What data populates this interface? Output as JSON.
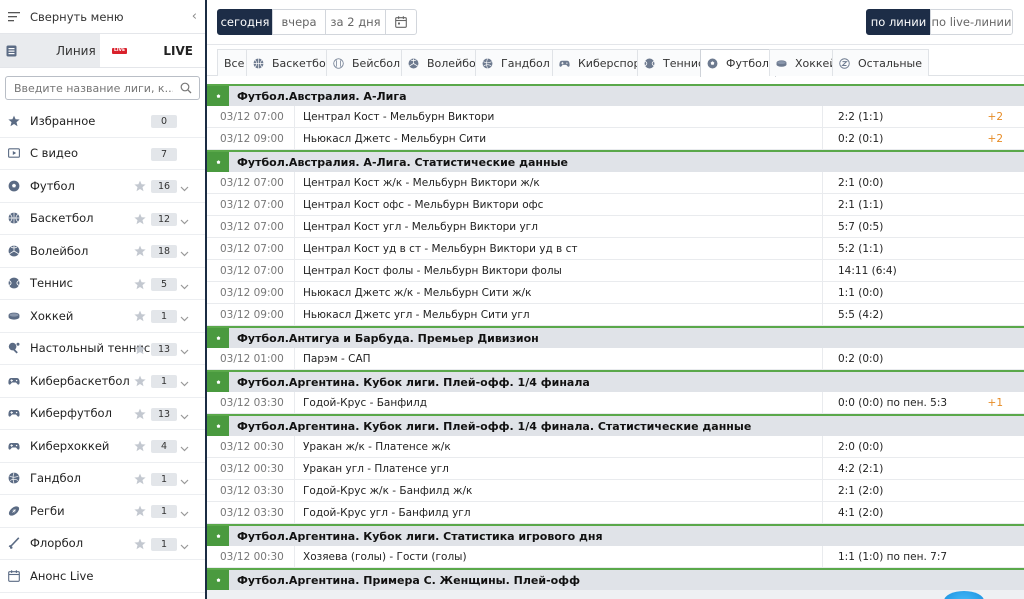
{
  "sidebar": {
    "collapse_label": "Свернуть меню",
    "tab_line": "Линия",
    "tab_live": "LIVE",
    "live_badge": "LIVE",
    "search_placeholder": "Введите название лиги, к...",
    "items": [
      {
        "label": "Избранное",
        "icon": "star-icon",
        "count": "0",
        "fav": false,
        "expand": false
      },
      {
        "label": "С видео",
        "icon": "video-icon",
        "count": "7",
        "fav": false,
        "expand": false
      },
      {
        "label": "Футбол",
        "icon": "soccer-ball-icon",
        "count": "16",
        "fav": true,
        "expand": true
      },
      {
        "label": "Баскетбол",
        "icon": "basketball-icon",
        "count": "12",
        "fav": true,
        "expand": true
      },
      {
        "label": "Волейбол",
        "icon": "volleyball-icon",
        "count": "18",
        "fav": true,
        "expand": true
      },
      {
        "label": "Теннис",
        "icon": "tennis-ball-icon",
        "count": "5",
        "fav": true,
        "expand": true
      },
      {
        "label": "Хоккей",
        "icon": "hockey-puck-icon",
        "count": "1",
        "fav": true,
        "expand": true
      },
      {
        "label": "Настольный теннис",
        "icon": "table-tennis-icon",
        "count": "13",
        "fav": true,
        "expand": true
      },
      {
        "label": "Кибербаскетбол",
        "icon": "gamepad-icon",
        "count": "1",
        "fav": true,
        "expand": true
      },
      {
        "label": "Киберфутбол",
        "icon": "gamepad-icon",
        "count": "13",
        "fav": true,
        "expand": true
      },
      {
        "label": "Киберхоккей",
        "icon": "gamepad-icon",
        "count": "4",
        "fav": true,
        "expand": true
      },
      {
        "label": "Гандбол",
        "icon": "handball-icon",
        "count": "1",
        "fav": true,
        "expand": true
      },
      {
        "label": "Регби",
        "icon": "rugby-ball-icon",
        "count": "1",
        "fav": true,
        "expand": true
      },
      {
        "label": "Флорбол",
        "icon": "floorball-icon",
        "count": "1",
        "fav": true,
        "expand": true
      },
      {
        "label": "Анонс Live",
        "icon": "calendar-icon",
        "count": "",
        "fav": false,
        "expand": false
      }
    ]
  },
  "datebar": {
    "today": "сегодня",
    "yesterday": "вчера",
    "two_days": "за 2 дня",
    "by_line": "по линии",
    "by_live": "по live-линии"
  },
  "sport_tabs": [
    {
      "label": "Все",
      "icon": ""
    },
    {
      "label": "Баскетбол",
      "icon": "basketball-icon"
    },
    {
      "label": "Бейсбол",
      "icon": "baseball-icon"
    },
    {
      "label": "Волейбол",
      "icon": "volleyball-icon"
    },
    {
      "label": "Гандбол",
      "icon": "handball-icon"
    },
    {
      "label": "Киберспорт",
      "icon": "gamepad-icon"
    },
    {
      "label": "Теннис",
      "icon": "tennis-ball-icon"
    },
    {
      "label": "Футбол",
      "icon": "soccer-ball-icon"
    },
    {
      "label": "Хоккей",
      "icon": "hockey-puck-icon"
    },
    {
      "label": "Остальные",
      "icon": "other-sports-icon"
    }
  ],
  "active_sport": "Футбол",
  "colors": {
    "accent": "#1d2d47",
    "league_bar": "#4a9a3f",
    "more_markets": "#e78b24"
  },
  "leagues": [
    {
      "title": "Футбол.Австралия. А-Лига",
      "events": [
        {
          "time": "03/12 07:00",
          "name": "Централ Кост - Мельбурн Виктори",
          "score": "2:2 (1:1)",
          "more": "+2"
        },
        {
          "time": "03/12 09:00",
          "name": "Ньюкасл Джетс - Мельбурн Сити",
          "score": "0:2 (0:1)",
          "more": "+2"
        }
      ]
    },
    {
      "title": "Футбол.Австралия. А-Лига. Статистические данные",
      "events": [
        {
          "time": "03/12 07:00",
          "name": "Централ Кост ж/к - Мельбурн Виктори ж/к",
          "score": "2:1 (0:0)",
          "more": ""
        },
        {
          "time": "03/12 07:00",
          "name": "Централ Кост офс - Мельбурн Виктори офс",
          "score": "2:1 (1:1)",
          "more": ""
        },
        {
          "time": "03/12 07:00",
          "name": "Централ Кост угл - Мельбурн Виктори угл",
          "score": "5:7 (0:5)",
          "more": ""
        },
        {
          "time": "03/12 07:00",
          "name": "Централ Кост уд в ст - Мельбурн Виктори уд в ст",
          "score": "5:2 (1:1)",
          "more": ""
        },
        {
          "time": "03/12 07:00",
          "name": "Централ Кост фолы - Мельбурн Виктори фолы",
          "score": "14:11 (6:4)",
          "more": ""
        },
        {
          "time": "03/12 09:00",
          "name": "Ньюкасл Джетс ж/к - Мельбурн Сити ж/к",
          "score": "1:1 (0:0)",
          "more": ""
        },
        {
          "time": "03/12 09:00",
          "name": "Ньюкасл Джетс угл - Мельбурн Сити угл",
          "score": "5:5 (4:2)",
          "more": ""
        }
      ]
    },
    {
      "title": "Футбол.Антигуа и Барбуда. Премьер Дивизион",
      "events": [
        {
          "time": "03/12 01:00",
          "name": "Парэм - САП",
          "score": "0:2 (0:0)",
          "more": ""
        }
      ]
    },
    {
      "title": "Футбол.Аргентина. Кубок лиги. Плей-офф. 1/4 финала",
      "events": [
        {
          "time": "03/12 03:30",
          "name": "Годой-Крус - Банфилд",
          "score": "0:0 (0:0) по пен. 5:3",
          "more": "+1"
        }
      ]
    },
    {
      "title": "Футбол.Аргентина. Кубок лиги. Плей-офф. 1/4 финала. Статистические данные",
      "events": [
        {
          "time": "03/12 00:30",
          "name": "Уракан ж/к - Платенсе ж/к",
          "score": "2:0 (0:0)",
          "more": ""
        },
        {
          "time": "03/12 00:30",
          "name": "Уракан угл - Платенсе угл",
          "score": "4:2 (2:1)",
          "more": ""
        },
        {
          "time": "03/12 03:30",
          "name": "Годой-Крус ж/к - Банфилд ж/к",
          "score": "2:1 (2:0)",
          "more": ""
        },
        {
          "time": "03/12 03:30",
          "name": "Годой-Крус угл - Банфилд угл",
          "score": "4:1 (2:0)",
          "more": ""
        }
      ]
    },
    {
      "title": "Футбол.Аргентина. Кубок лиги. Статистика игрового дня",
      "events": [
        {
          "time": "03/12 00:30",
          "name": "Хозяева (голы) - Гости (голы)",
          "score": "1:1 (1:0) по пен. 7:7",
          "more": ""
        }
      ]
    },
    {
      "title": "Футбол.Аргентина. Примера С. Женщины. Плей-офф",
      "events": []
    }
  ]
}
